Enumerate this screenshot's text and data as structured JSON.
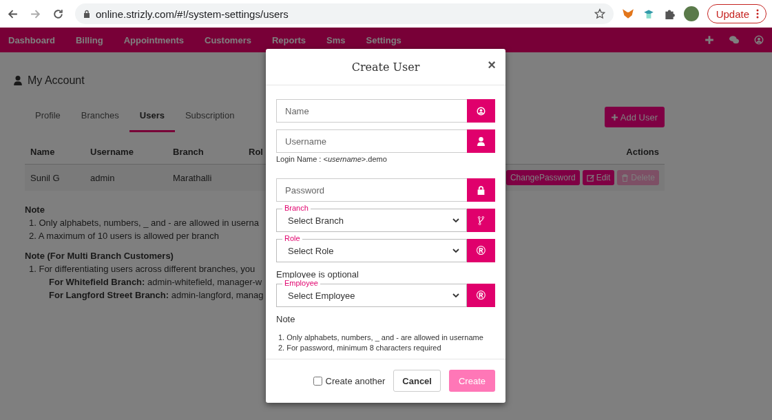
{
  "browser": {
    "url": "online.strizly.com/#!/system-settings/users",
    "update_label": "Update"
  },
  "nav": {
    "items": [
      "Dashboard",
      "Billing",
      "Appointments",
      "Customers",
      "Reports",
      "Sms",
      "Settings"
    ]
  },
  "page": {
    "title": "My Account",
    "tabs": [
      {
        "label": "Profile",
        "selected": false
      },
      {
        "label": "Branches",
        "selected": false
      },
      {
        "label": "Users",
        "selected": true
      },
      {
        "label": "Subscription",
        "selected": false
      }
    ],
    "add_user_label": "Add User",
    "table": {
      "columns": [
        "Name",
        "Username",
        "Branch",
        "Rol",
        "Actions"
      ],
      "rows": [
        {
          "cells": [
            "Sunil G",
            "admin",
            "Marathalli"
          ],
          "actions": [
            {
              "label": "ChangePassword",
              "kind": "password",
              "disabled": false
            },
            {
              "label": "Edit",
              "kind": "edit",
              "disabled": false
            },
            {
              "label": "Delete",
              "kind": "delete",
              "disabled": true
            }
          ]
        }
      ]
    },
    "note_title": "Note",
    "notes": [
      "1. Only alphabets, numbers, _ and - are allowed in userna",
      "2. A maximum of 10 users is allowed per branch"
    ],
    "multi_note_title": "Note (For Multi Branch Customers)",
    "multi_notes": [
      "1. For differentiating users across different branches, you"
    ],
    "examples": [
      "**For Whitefield Branch:** admin-whitefield, manager-w",
      "**For Langford Street Branch:** admin-langford, manag"
    ]
  },
  "modal": {
    "title": "Create User",
    "close": "×",
    "fields": [
      {
        "kind": "name",
        "placeholder": "Name"
      },
      {
        "kind": "username",
        "placeholder": "Username"
      },
      {
        "kind": "hint",
        "text": "Login Name : <*username*>.demo"
      },
      {
        "kind": "password",
        "placeholder": "Password"
      },
      {
        "kind": "branch",
        "label": "Branch",
        "value": "Select Branch"
      },
      {
        "kind": "role",
        "label": "Role",
        "value": "Select Role",
        "symbol": "®"
      },
      {
        "kind": "text",
        "text": "Employee is optional"
      },
      {
        "kind": "employee",
        "label": "Employee",
        "value": "Select Employee",
        "symbol": "®"
      }
    ],
    "note_title": "Note",
    "notes": [
      "1. Only alphabets, numbers, _ and - are allowed in username",
      "2. For password, minimum 8 characters required"
    ],
    "create_another": {
      "label": "Create another",
      "checked": false
    },
    "cancel_label": "Cancel",
    "create": {
      "label": "Create",
      "disabled": true
    }
  }
}
